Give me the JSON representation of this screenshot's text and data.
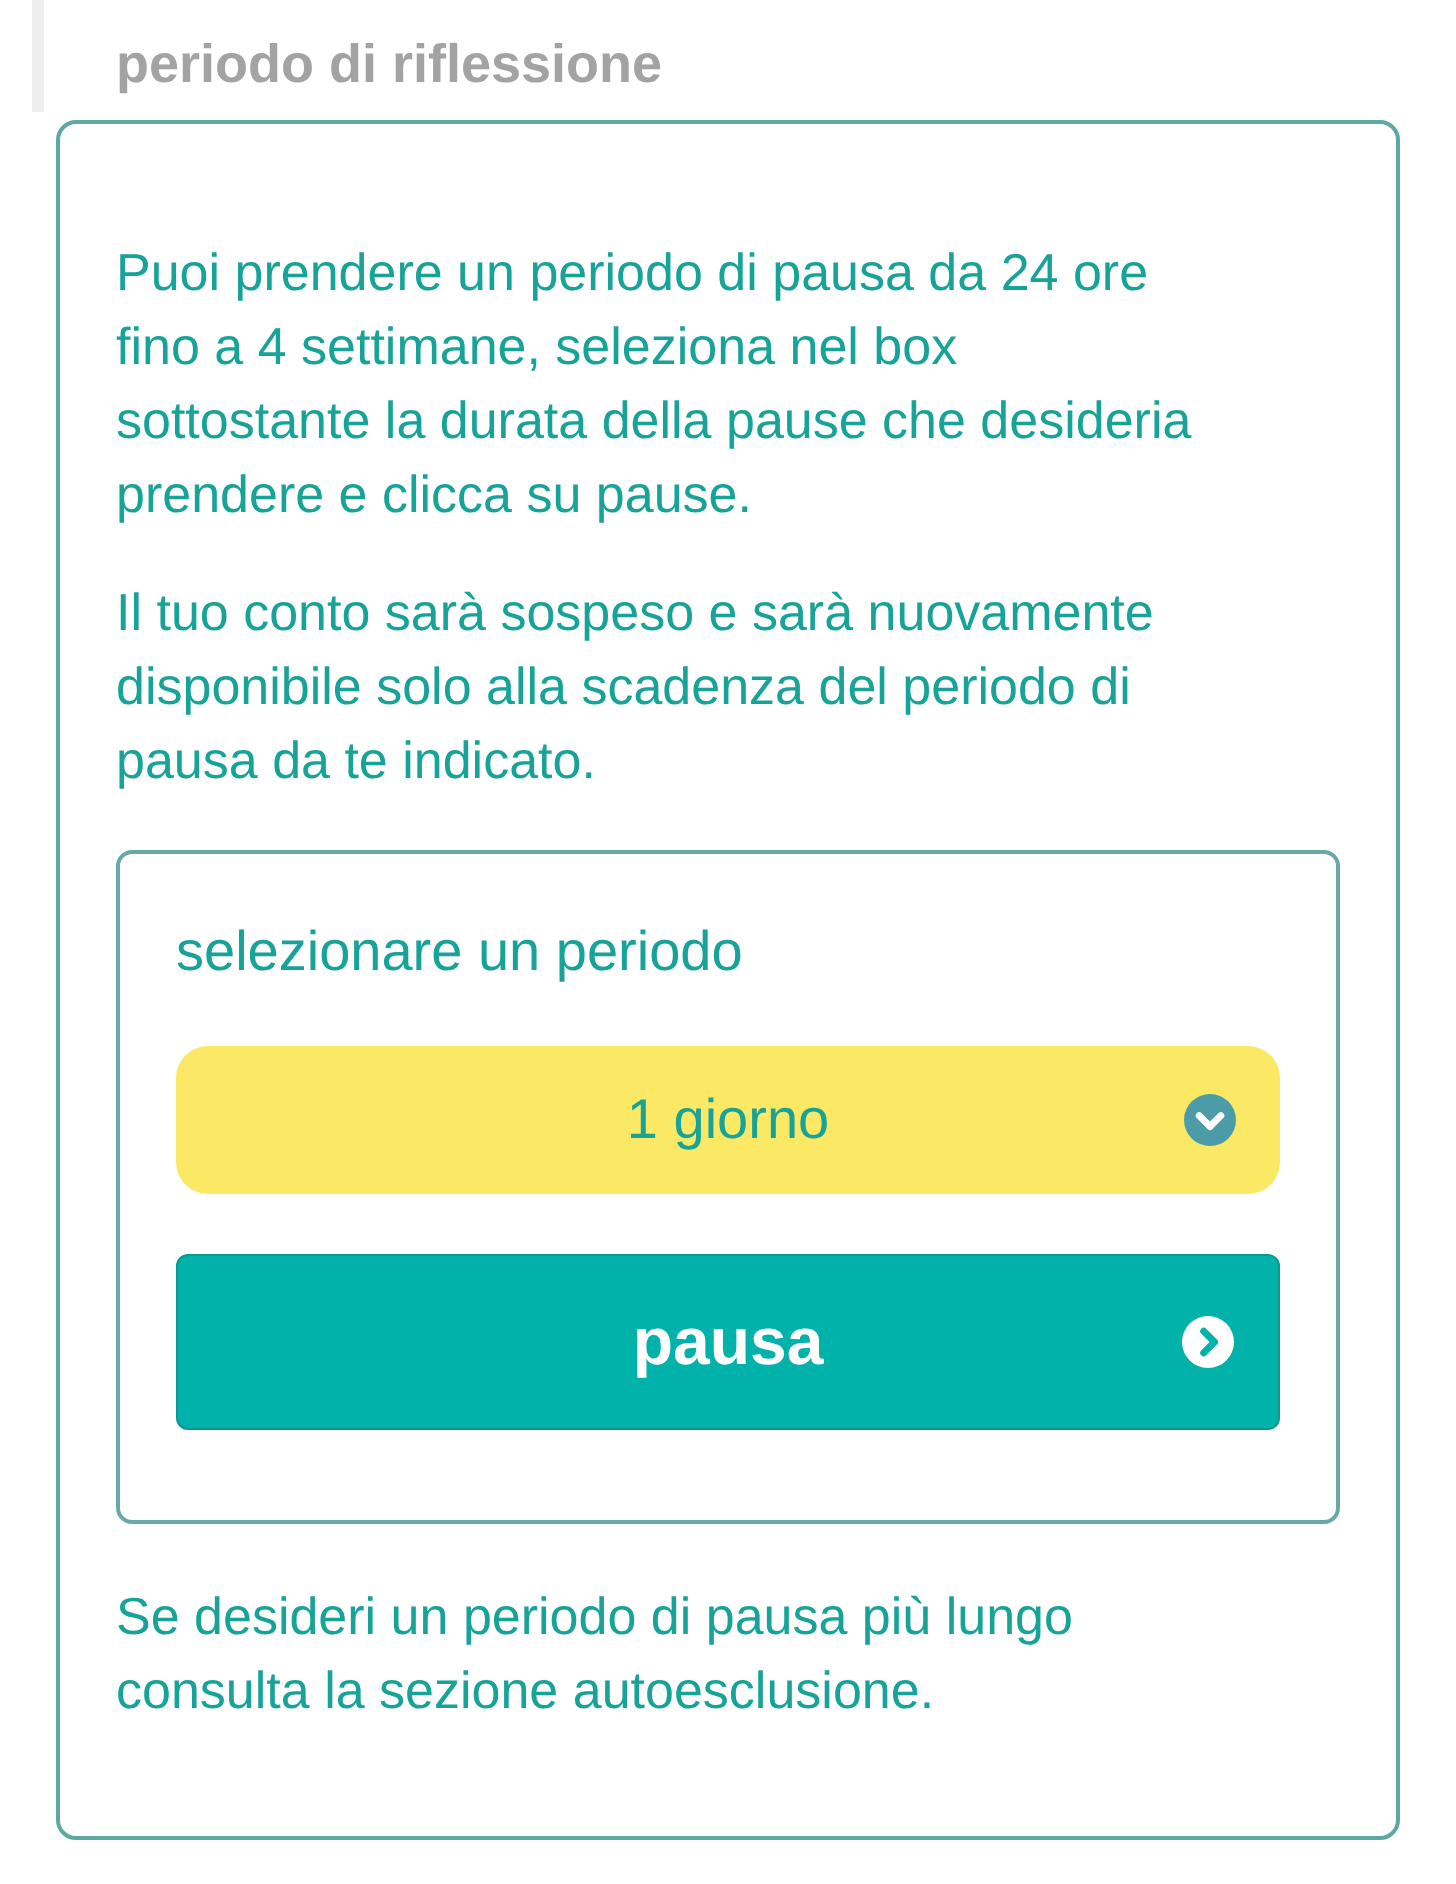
{
  "heading": "periodo di riflessione",
  "paragraphs": [
    "Puoi prendere un periodo di pausa da 24 ore\nfino a 4 settimane, seleziona nel box\nsottostante la durata della pause che desideria\nprendere e clicca su pause.",
    "Il tuo conto sarà sospeso e sarà nuovamente\ndisponibile solo alla scadenza del periodo di\npausa da te indicato."
  ],
  "period_selector": {
    "label": "selezionare un periodo",
    "value": "1 giorno"
  },
  "submit_button": {
    "label": "pausa"
  },
  "footer_note": "Se desideri un periodo di pausa più lungo\nconsulta la sezione autoesclusione."
}
